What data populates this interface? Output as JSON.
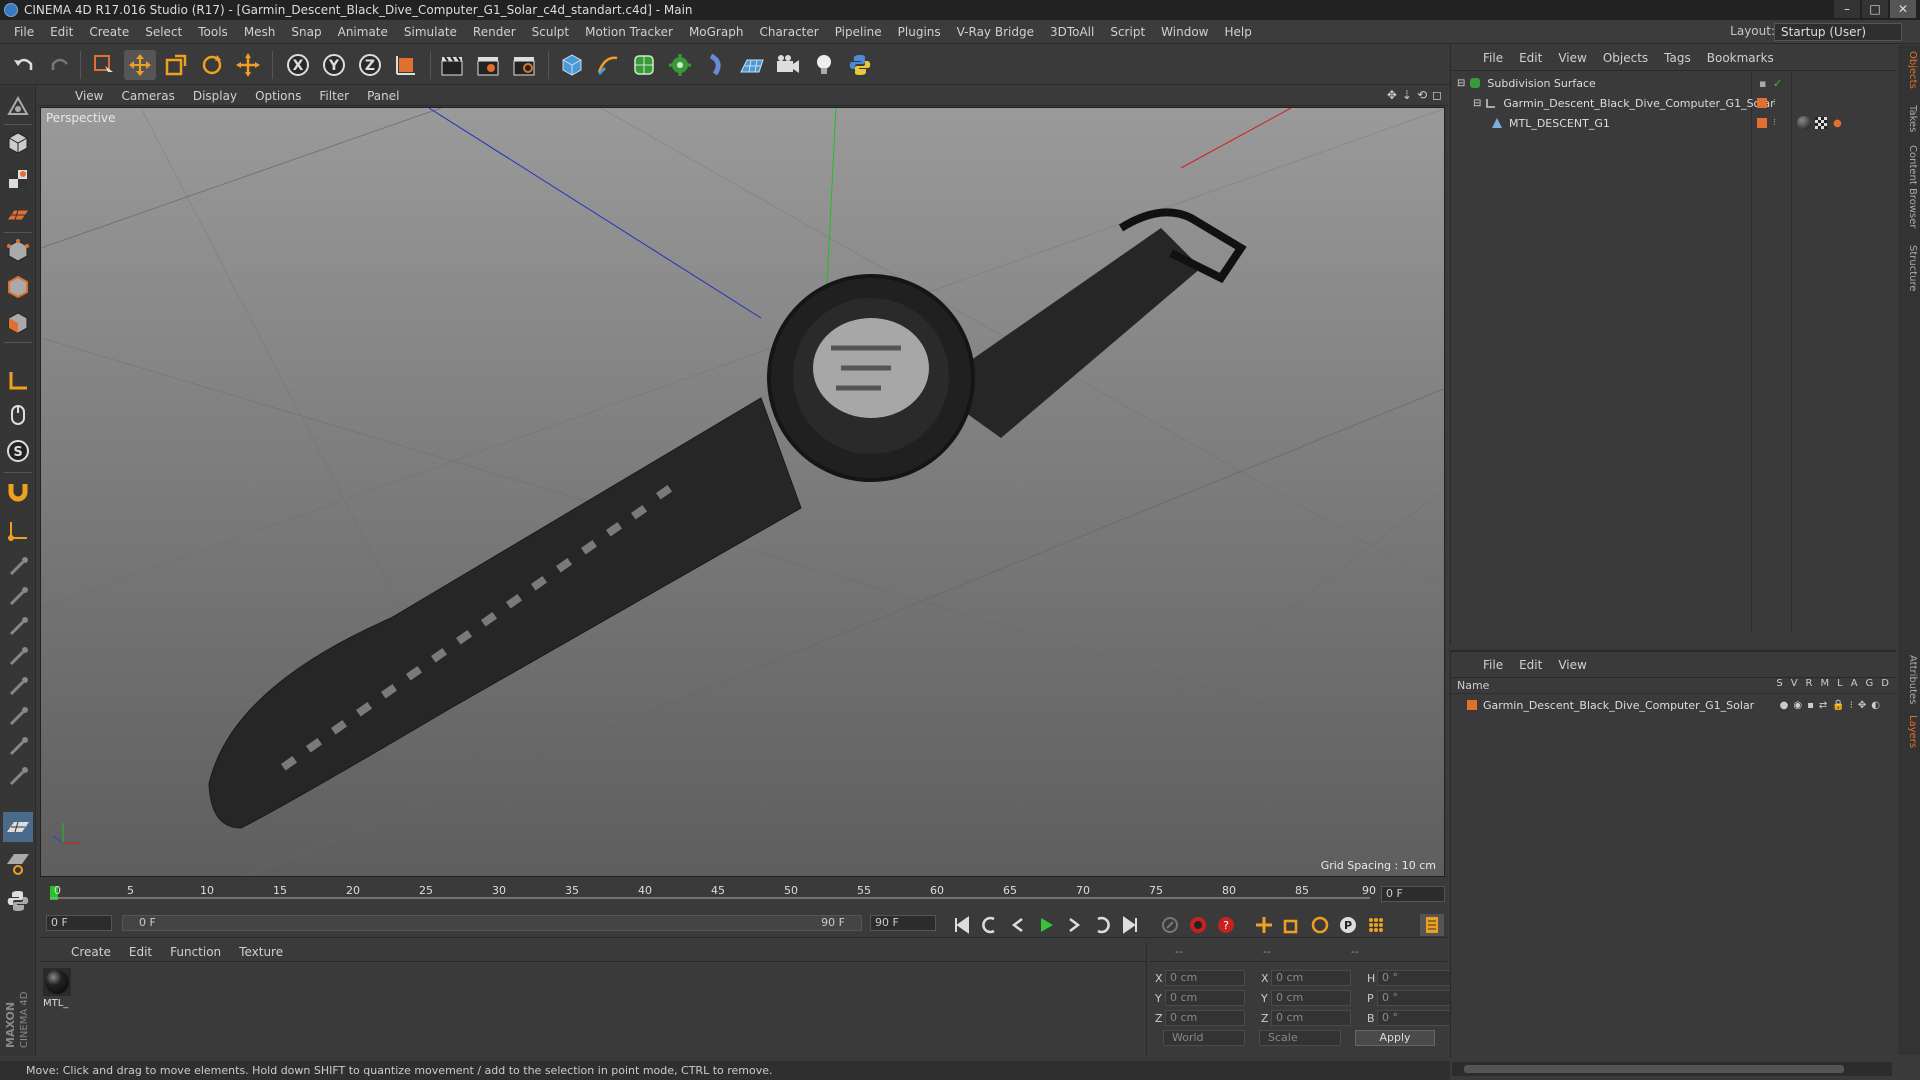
{
  "window": {
    "title": "CINEMA 4D R17.016 Studio (R17) - [Garmin_Descent_Black_Dive_Computer_G1_Solar_c4d_standart.c4d] - Main",
    "controls": [
      "–",
      "□",
      "✕"
    ]
  },
  "menubar": [
    "File",
    "Edit",
    "Create",
    "Select",
    "Tools",
    "Mesh",
    "Snap",
    "Animate",
    "Simulate",
    "Render",
    "Sculpt",
    "Motion Tracker",
    "MoGraph",
    "Character",
    "Pipeline",
    "Plugins",
    "V-Ray Bridge",
    "3DToAll",
    "Script",
    "Window",
    "Help"
  ],
  "layout": {
    "label": "Layout:",
    "value": "Startup (User)"
  },
  "viewport": {
    "menu": [
      "View",
      "Cameras",
      "Display",
      "Options",
      "Filter",
      "Panel"
    ],
    "label": "Perspective",
    "grid_spacing": "Grid Spacing : 10 cm"
  },
  "timeline": {
    "ticks": [
      "0",
      "5",
      "10",
      "15",
      "20",
      "25",
      "30",
      "35",
      "40",
      "45",
      "50",
      "55",
      "60",
      "65",
      "70",
      "75",
      "80",
      "85",
      "90"
    ],
    "end_field": "0 F"
  },
  "playback": {
    "start_field": "0 F",
    "range_start": "0 F",
    "range_end": "90 F",
    "end_field": "90 F"
  },
  "materials": {
    "menu": [
      "Create",
      "Edit",
      "Function",
      "Texture"
    ],
    "items": [
      {
        "name": "MTL_"
      }
    ]
  },
  "coordinates": {
    "headers": [
      "--",
      "--",
      "--"
    ],
    "rows": [
      {
        "a": "X",
        "av": "0 cm",
        "b": "X",
        "bv": "0 cm",
        "c": "H",
        "cv": "0 °"
      },
      {
        "a": "Y",
        "av": "0 cm",
        "b": "Y",
        "bv": "0 cm",
        "c": "P",
        "cv": "0 °"
      },
      {
        "a": "Z",
        "av": "0 cm",
        "b": "Z",
        "bv": "0 cm",
        "c": "B",
        "cv": "0 °"
      }
    ],
    "mode": "World",
    "transform": "Scale",
    "apply": "Apply"
  },
  "status": "Move: Click and drag to move elements. Hold down SHIFT to quantize movement / add to the selection in point mode, CTRL to remove.",
  "objects": {
    "menu": [
      "File",
      "Edit",
      "View",
      "Objects",
      "Tags",
      "Bookmarks"
    ],
    "tree": [
      {
        "name": "Subdivision Surface",
        "level": 0
      },
      {
        "name": "Garmin_Descent_Black_Dive_Computer_G1_Solar",
        "level": 1
      },
      {
        "name": "MTL_DESCENT_G1",
        "level": 2
      }
    ]
  },
  "layers": {
    "menu": [
      "File",
      "Edit",
      "View"
    ],
    "header": "Name",
    "cols": [
      "S",
      "V",
      "R",
      "M",
      "L",
      "A",
      "G",
      "D"
    ],
    "row": "Garmin_Descent_Black_Dive_Computer_G1_Solar"
  },
  "sidetabs": [
    "Objects",
    "Takes",
    "Content Browser",
    "Structure",
    "Attributes",
    "Layers"
  ],
  "colors": {
    "accent": "#e07030",
    "axis_x": "#d03030",
    "axis_y": "#30c030",
    "axis_z": "#3040d0"
  }
}
